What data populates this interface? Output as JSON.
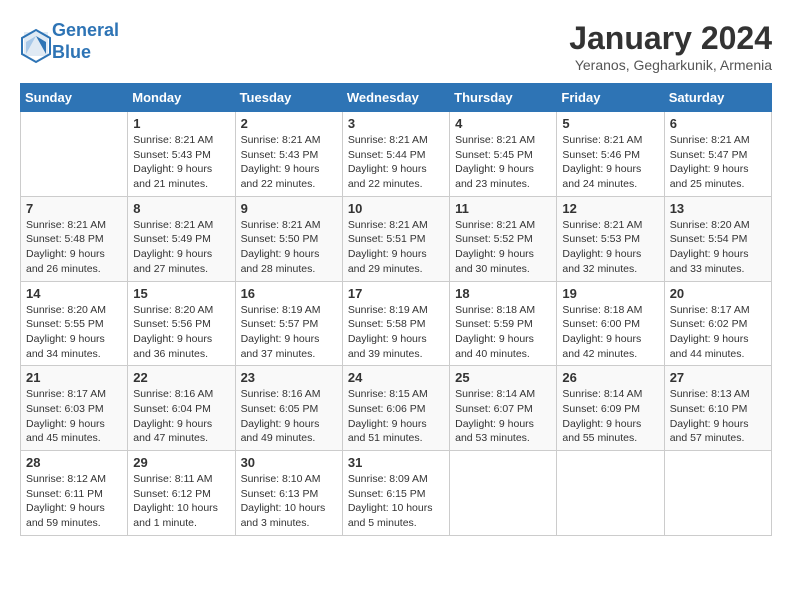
{
  "logo": {
    "line1": "General",
    "line2": "Blue"
  },
  "title": "January 2024",
  "location": "Yeranos, Gegharkunik, Armenia",
  "days_header": [
    "Sunday",
    "Monday",
    "Tuesday",
    "Wednesday",
    "Thursday",
    "Friday",
    "Saturday"
  ],
  "weeks": [
    [
      {
        "day": "",
        "sunrise": "",
        "sunset": "",
        "daylight": ""
      },
      {
        "day": "1",
        "sunrise": "Sunrise: 8:21 AM",
        "sunset": "Sunset: 5:43 PM",
        "daylight": "Daylight: 9 hours and 21 minutes."
      },
      {
        "day": "2",
        "sunrise": "Sunrise: 8:21 AM",
        "sunset": "Sunset: 5:43 PM",
        "daylight": "Daylight: 9 hours and 22 minutes."
      },
      {
        "day": "3",
        "sunrise": "Sunrise: 8:21 AM",
        "sunset": "Sunset: 5:44 PM",
        "daylight": "Daylight: 9 hours and 22 minutes."
      },
      {
        "day": "4",
        "sunrise": "Sunrise: 8:21 AM",
        "sunset": "Sunset: 5:45 PM",
        "daylight": "Daylight: 9 hours and 23 minutes."
      },
      {
        "day": "5",
        "sunrise": "Sunrise: 8:21 AM",
        "sunset": "Sunset: 5:46 PM",
        "daylight": "Daylight: 9 hours and 24 minutes."
      },
      {
        "day": "6",
        "sunrise": "Sunrise: 8:21 AM",
        "sunset": "Sunset: 5:47 PM",
        "daylight": "Daylight: 9 hours and 25 minutes."
      }
    ],
    [
      {
        "day": "7",
        "sunrise": "Sunrise: 8:21 AM",
        "sunset": "Sunset: 5:48 PM",
        "daylight": "Daylight: 9 hours and 26 minutes."
      },
      {
        "day": "8",
        "sunrise": "Sunrise: 8:21 AM",
        "sunset": "Sunset: 5:49 PM",
        "daylight": "Daylight: 9 hours and 27 minutes."
      },
      {
        "day": "9",
        "sunrise": "Sunrise: 8:21 AM",
        "sunset": "Sunset: 5:50 PM",
        "daylight": "Daylight: 9 hours and 28 minutes."
      },
      {
        "day": "10",
        "sunrise": "Sunrise: 8:21 AM",
        "sunset": "Sunset: 5:51 PM",
        "daylight": "Daylight: 9 hours and 29 minutes."
      },
      {
        "day": "11",
        "sunrise": "Sunrise: 8:21 AM",
        "sunset": "Sunset: 5:52 PM",
        "daylight": "Daylight: 9 hours and 30 minutes."
      },
      {
        "day": "12",
        "sunrise": "Sunrise: 8:21 AM",
        "sunset": "Sunset: 5:53 PM",
        "daylight": "Daylight: 9 hours and 32 minutes."
      },
      {
        "day": "13",
        "sunrise": "Sunrise: 8:20 AM",
        "sunset": "Sunset: 5:54 PM",
        "daylight": "Daylight: 9 hours and 33 minutes."
      }
    ],
    [
      {
        "day": "14",
        "sunrise": "Sunrise: 8:20 AM",
        "sunset": "Sunset: 5:55 PM",
        "daylight": "Daylight: 9 hours and 34 minutes."
      },
      {
        "day": "15",
        "sunrise": "Sunrise: 8:20 AM",
        "sunset": "Sunset: 5:56 PM",
        "daylight": "Daylight: 9 hours and 36 minutes."
      },
      {
        "day": "16",
        "sunrise": "Sunrise: 8:19 AM",
        "sunset": "Sunset: 5:57 PM",
        "daylight": "Daylight: 9 hours and 37 minutes."
      },
      {
        "day": "17",
        "sunrise": "Sunrise: 8:19 AM",
        "sunset": "Sunset: 5:58 PM",
        "daylight": "Daylight: 9 hours and 39 minutes."
      },
      {
        "day": "18",
        "sunrise": "Sunrise: 8:18 AM",
        "sunset": "Sunset: 5:59 PM",
        "daylight": "Daylight: 9 hours and 40 minutes."
      },
      {
        "day": "19",
        "sunrise": "Sunrise: 8:18 AM",
        "sunset": "Sunset: 6:00 PM",
        "daylight": "Daylight: 9 hours and 42 minutes."
      },
      {
        "day": "20",
        "sunrise": "Sunrise: 8:17 AM",
        "sunset": "Sunset: 6:02 PM",
        "daylight": "Daylight: 9 hours and 44 minutes."
      }
    ],
    [
      {
        "day": "21",
        "sunrise": "Sunrise: 8:17 AM",
        "sunset": "Sunset: 6:03 PM",
        "daylight": "Daylight: 9 hours and 45 minutes."
      },
      {
        "day": "22",
        "sunrise": "Sunrise: 8:16 AM",
        "sunset": "Sunset: 6:04 PM",
        "daylight": "Daylight: 9 hours and 47 minutes."
      },
      {
        "day": "23",
        "sunrise": "Sunrise: 8:16 AM",
        "sunset": "Sunset: 6:05 PM",
        "daylight": "Daylight: 9 hours and 49 minutes."
      },
      {
        "day": "24",
        "sunrise": "Sunrise: 8:15 AM",
        "sunset": "Sunset: 6:06 PM",
        "daylight": "Daylight: 9 hours and 51 minutes."
      },
      {
        "day": "25",
        "sunrise": "Sunrise: 8:14 AM",
        "sunset": "Sunset: 6:07 PM",
        "daylight": "Daylight: 9 hours and 53 minutes."
      },
      {
        "day": "26",
        "sunrise": "Sunrise: 8:14 AM",
        "sunset": "Sunset: 6:09 PM",
        "daylight": "Daylight: 9 hours and 55 minutes."
      },
      {
        "day": "27",
        "sunrise": "Sunrise: 8:13 AM",
        "sunset": "Sunset: 6:10 PM",
        "daylight": "Daylight: 9 hours and 57 minutes."
      }
    ],
    [
      {
        "day": "28",
        "sunrise": "Sunrise: 8:12 AM",
        "sunset": "Sunset: 6:11 PM",
        "daylight": "Daylight: 9 hours and 59 minutes."
      },
      {
        "day": "29",
        "sunrise": "Sunrise: 8:11 AM",
        "sunset": "Sunset: 6:12 PM",
        "daylight": "Daylight: 10 hours and 1 minute."
      },
      {
        "day": "30",
        "sunrise": "Sunrise: 8:10 AM",
        "sunset": "Sunset: 6:13 PM",
        "daylight": "Daylight: 10 hours and 3 minutes."
      },
      {
        "day": "31",
        "sunrise": "Sunrise: 8:09 AM",
        "sunset": "Sunset: 6:15 PM",
        "daylight": "Daylight: 10 hours and 5 minutes."
      },
      {
        "day": "",
        "sunrise": "",
        "sunset": "",
        "daylight": ""
      },
      {
        "day": "",
        "sunrise": "",
        "sunset": "",
        "daylight": ""
      },
      {
        "day": "",
        "sunrise": "",
        "sunset": "",
        "daylight": ""
      }
    ]
  ]
}
